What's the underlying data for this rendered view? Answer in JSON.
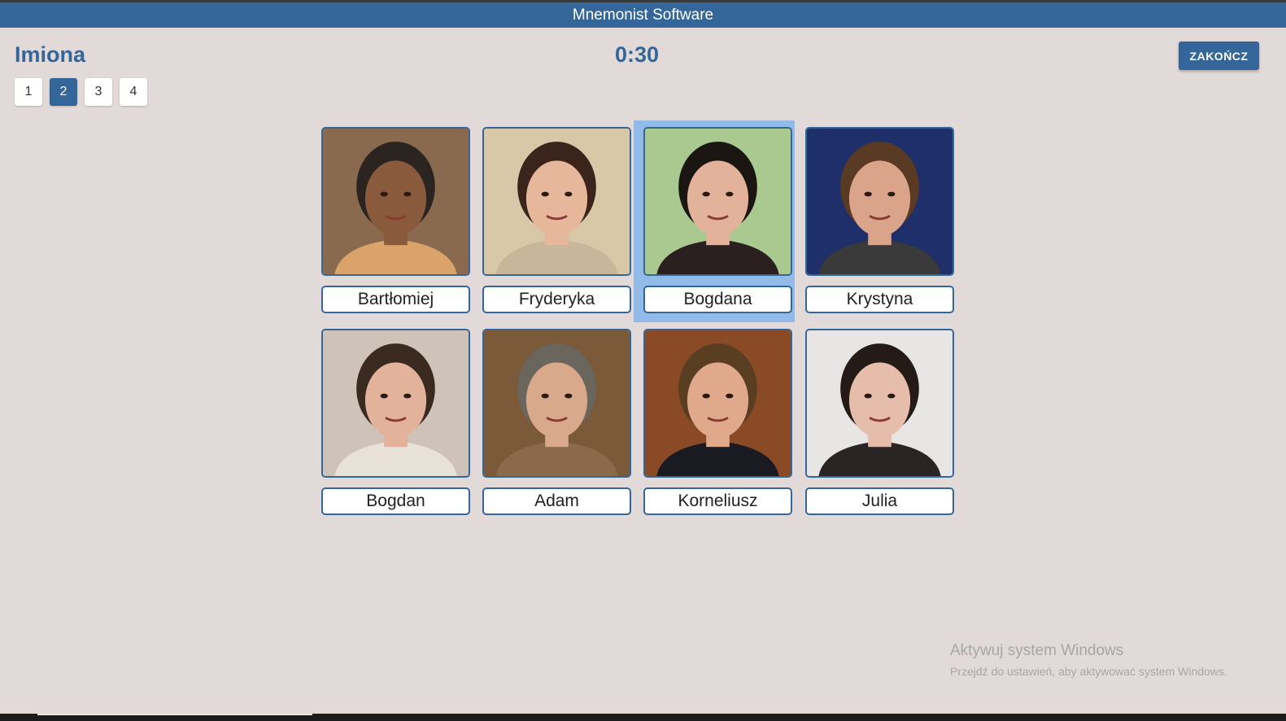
{
  "window": {
    "title": "Mnemonist Software"
  },
  "header": {
    "title": "Imiona",
    "timer": "0:30",
    "end_label": "ZAKOŃCZ"
  },
  "pages": [
    {
      "label": "1",
      "active": false
    },
    {
      "label": "2",
      "active": true
    },
    {
      "label": "3",
      "active": false
    },
    {
      "label": "4",
      "active": false
    }
  ],
  "cards": [
    {
      "name": "Bartłomiej",
      "selected": false,
      "bg": "#8a6a4e",
      "skin": "#8a5a3c",
      "hair": "#2b2420",
      "shirt": "#d9a36a"
    },
    {
      "name": "Fryderyka",
      "selected": false,
      "bg": "#d8c8a8",
      "skin": "#e7b79c",
      "hair": "#3b241c",
      "shirt": "#c9b69a"
    },
    {
      "name": "Bogdana",
      "selected": true,
      "bg": "#a9c990",
      "skin": "#e2b39a",
      "hair": "#1c1612",
      "shirt": "#2a2020"
    },
    {
      "name": "Krystyna",
      "selected": false,
      "bg": "#1f2f6a",
      "skin": "#d9a48a",
      "hair": "#5a3a22",
      "shirt": "#3a3a3a"
    },
    {
      "name": "Bogdan",
      "selected": false,
      "bg": "#cfc2b8",
      "skin": "#e2b39a",
      "hair": "#3a2a20",
      "shirt": "#e8e2d8"
    },
    {
      "name": "Adam",
      "selected": false,
      "bg": "#7a5a38",
      "skin": "#d9a98c",
      "hair": "#6a665e",
      "shirt": "#8a6a4a"
    },
    {
      "name": "Korneliusz",
      "selected": false,
      "bg": "#8a4a26",
      "skin": "#e0a98c",
      "hair": "#5a3e22",
      "shirt": "#1a1a22"
    },
    {
      "name": "Julia",
      "selected": false,
      "bg": "#e8e6e4",
      "skin": "#e6bcaa",
      "hair": "#241a16",
      "shirt": "#2a2424"
    }
  ],
  "watermark": {
    "title": "Aktywuj system Windows",
    "subtitle": "Przejdź do ustawień, aby aktywować system Windows."
  }
}
